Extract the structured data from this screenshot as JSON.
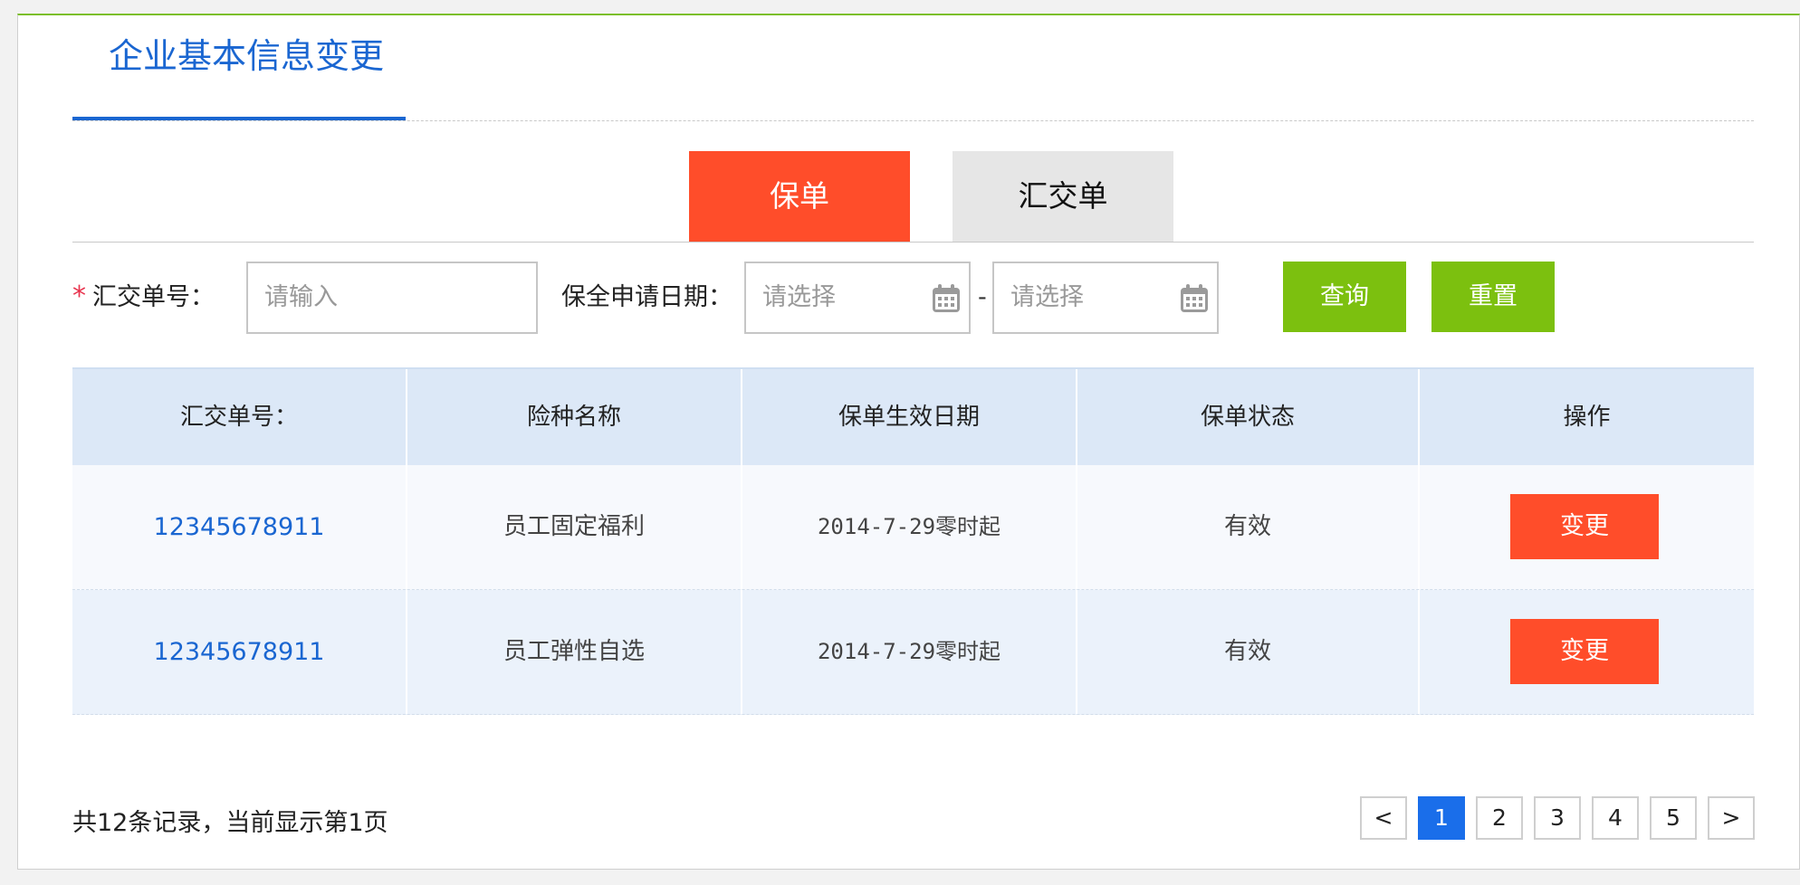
{
  "header": {
    "title": "企业基本信息变更"
  },
  "tabs": [
    {
      "label": "保单",
      "active": true
    },
    {
      "label": "汇交单",
      "active": false
    }
  ],
  "form": {
    "required_mark": "*",
    "policy_no_label": "汇交单号：",
    "policy_no_placeholder": "请输入",
    "date_label": "保全申请日期：",
    "date_start_placeholder": "请选择",
    "date_separator": "-",
    "date_end_placeholder": "请选择",
    "query_button": "查询",
    "reset_button": "重置"
  },
  "table": {
    "columns": [
      "汇交单号：",
      "险种名称",
      "保单生效日期",
      "保单状态",
      "操作"
    ],
    "rows": [
      {
        "policy_no": "12345678911",
        "product": "员工固定福利",
        "effective_date": "2014-7-29零时起",
        "status": "有效",
        "action": "变更"
      },
      {
        "policy_no": "12345678911",
        "product": "员工弹性自选",
        "effective_date": "2014-7-29零时起",
        "status": "有效",
        "action": "变更"
      }
    ]
  },
  "footer": {
    "summary": "共12条记录，当前显示第1页",
    "pager": {
      "prev": "<",
      "pages": [
        "1",
        "2",
        "3",
        "4",
        "5"
      ],
      "current": "1",
      "next": ">"
    }
  },
  "colors": {
    "accent_blue": "#1a66d1",
    "tab_active": "#ff4d2a",
    "button_green": "#7cc00f",
    "page_active": "#1a6eea"
  },
  "icons": {
    "date_picker": "calendar-icon"
  }
}
